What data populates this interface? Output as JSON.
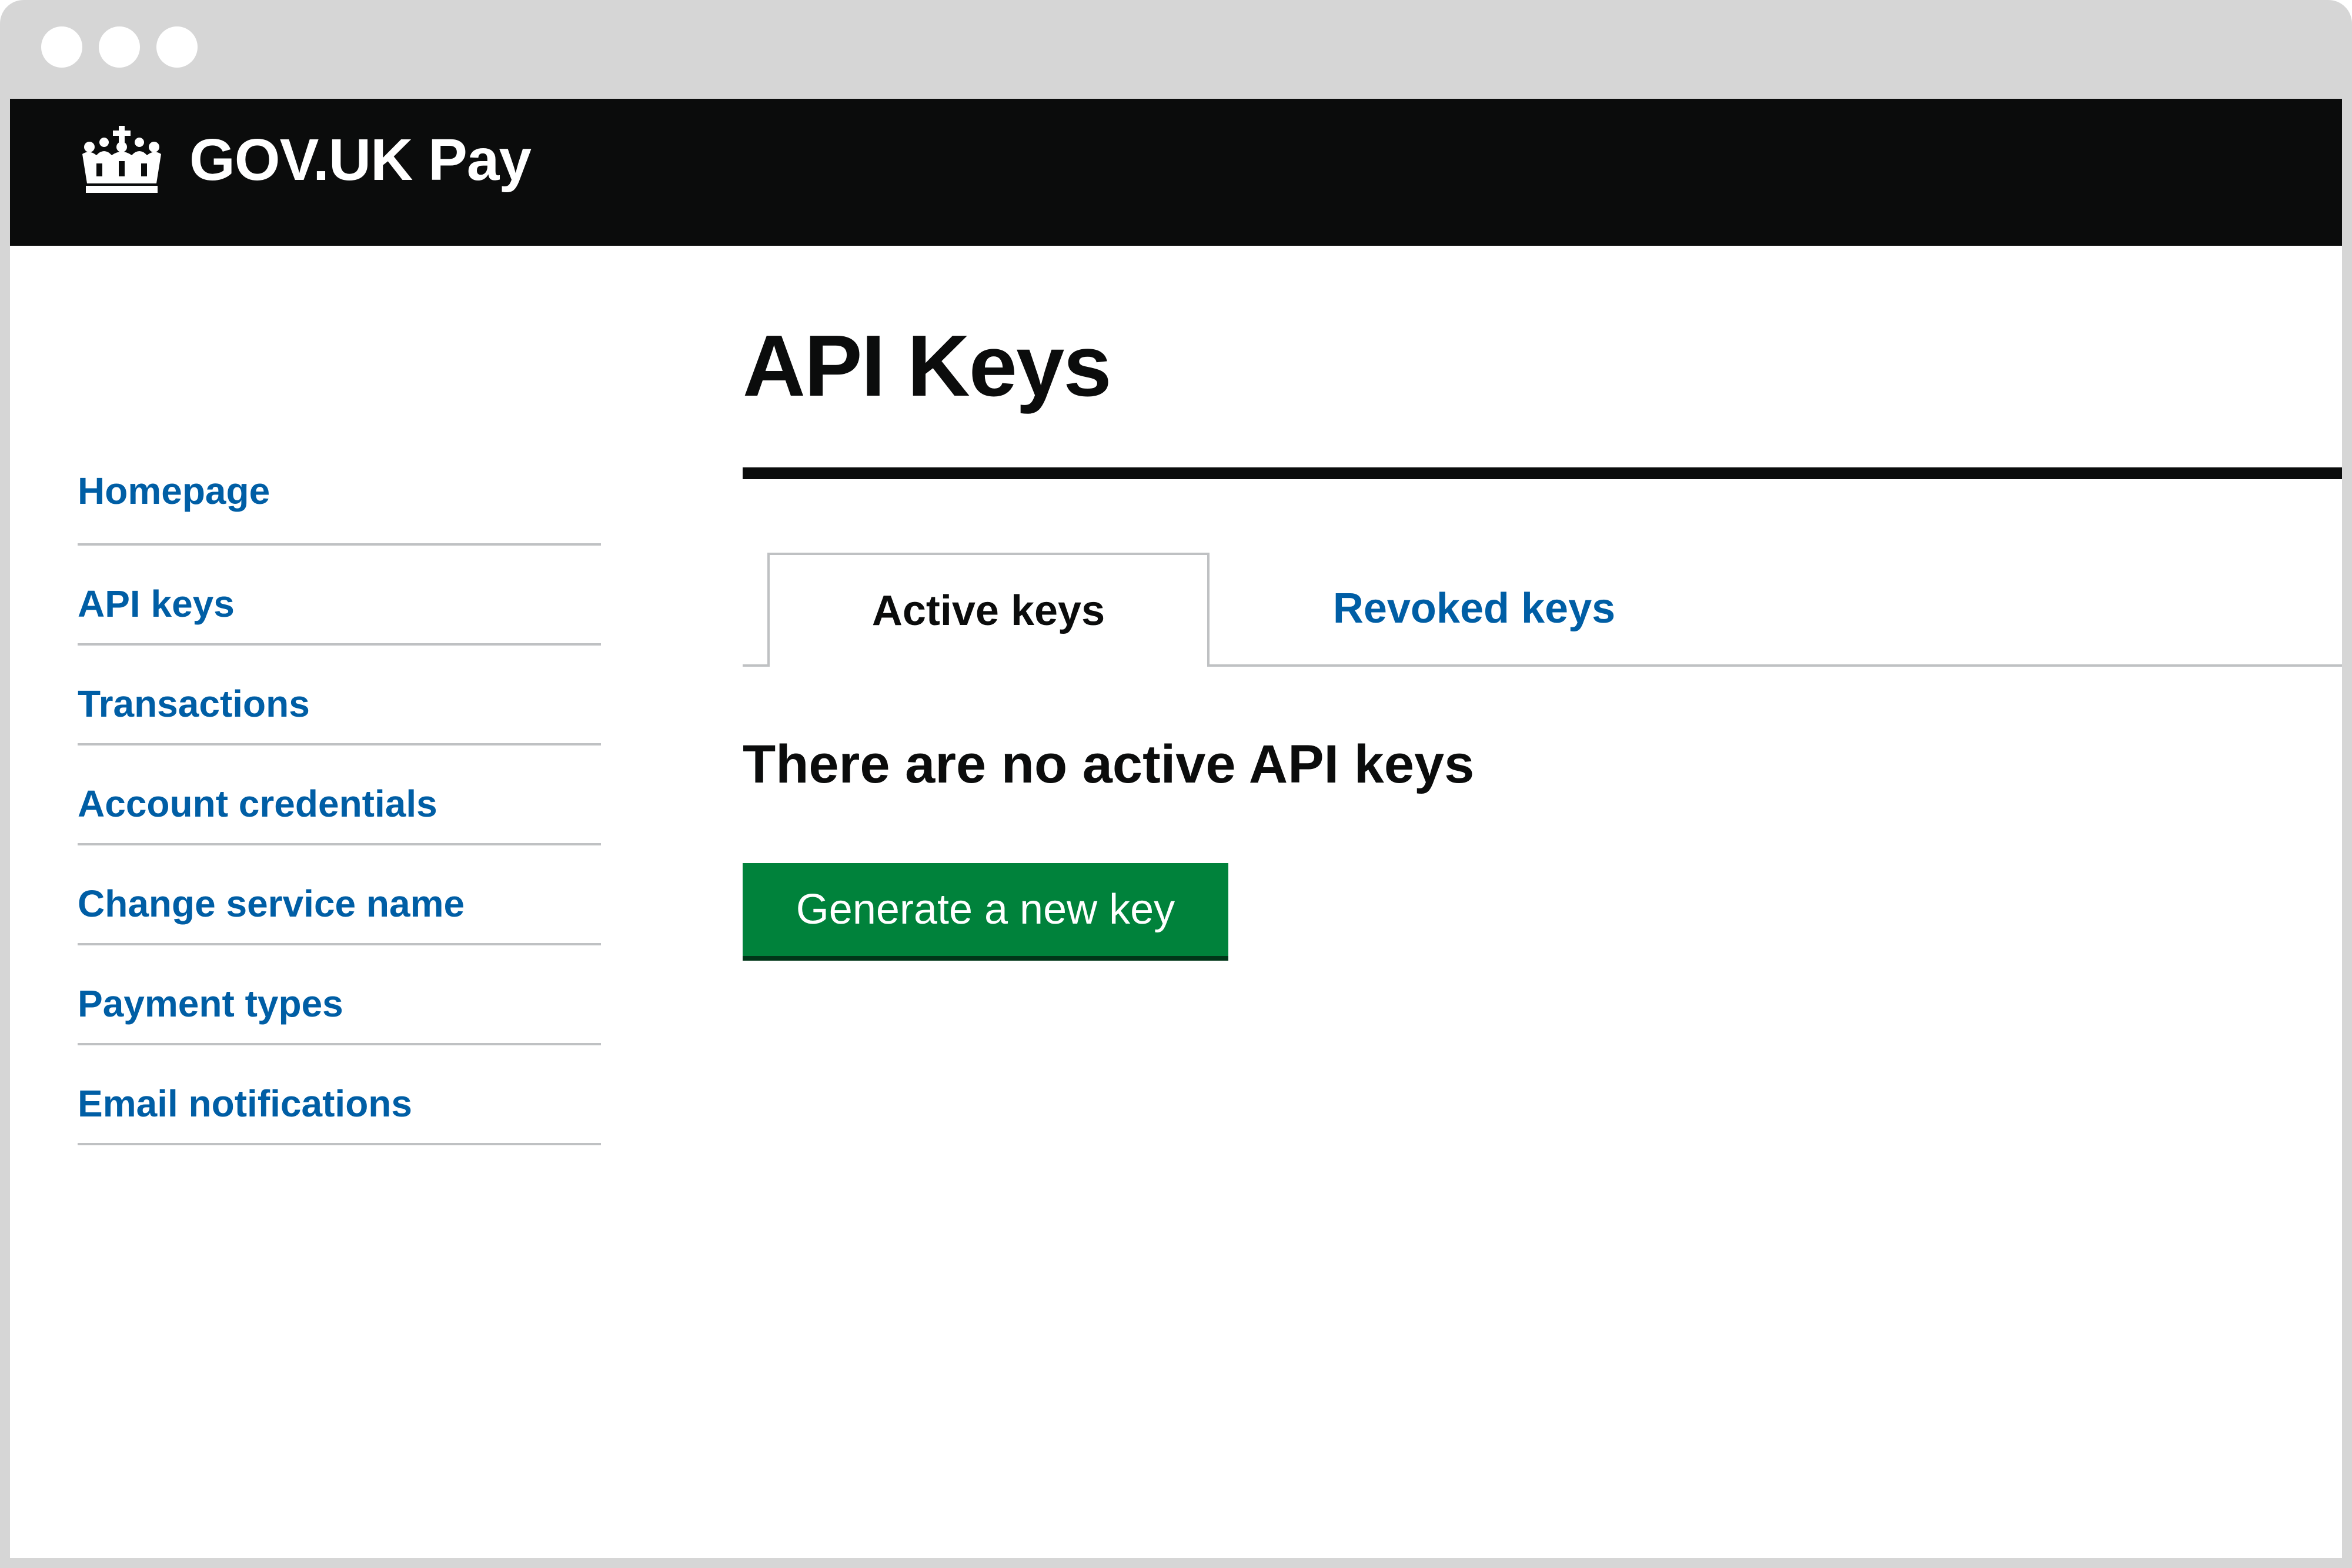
{
  "header": {
    "brand_name": "GOV.UK Pay",
    "logo_icon": "crown-icon"
  },
  "sidebar": {
    "items": [
      {
        "label": "Homepage"
      },
      {
        "label": "API keys"
      },
      {
        "label": "Transactions"
      },
      {
        "label": "Account credentials"
      },
      {
        "label": "Change service name"
      },
      {
        "label": "Payment types"
      },
      {
        "label": "Email notifications"
      }
    ]
  },
  "main": {
    "title": "API Keys",
    "tabs": [
      {
        "label": "Active keys",
        "active": true
      },
      {
        "label": "Revoked keys",
        "active": false
      }
    ],
    "empty_message": "There are no active API keys",
    "generate_button_label": "Generate a new key"
  },
  "colors": {
    "header_bg": "#0b0c0c",
    "link": "#005ea5",
    "button_bg": "#00823b",
    "text": "#0b0c0c",
    "border": "#bfc1c3",
    "window_chrome": "#d6d6d6"
  }
}
